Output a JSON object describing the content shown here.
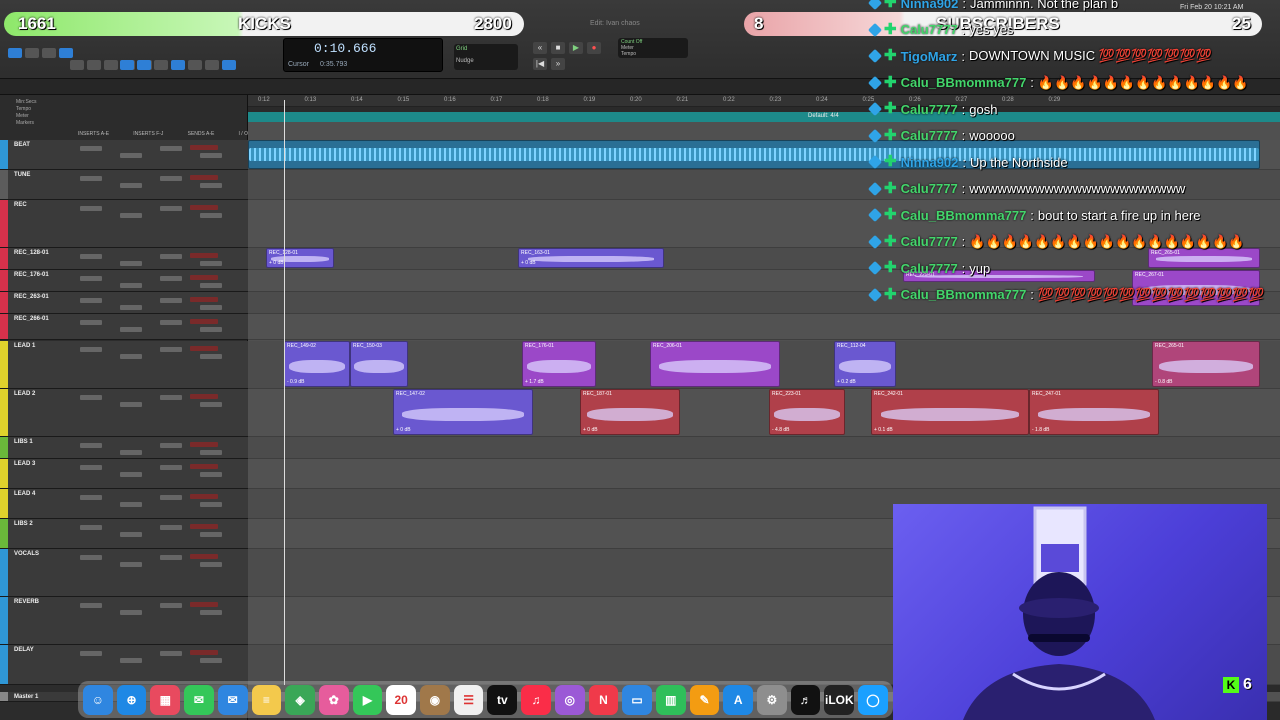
{
  "overlay": {
    "kicks_left": "1661",
    "kicks_label": "KICKS",
    "kicks_goal": "2800",
    "subs_left": "8",
    "subs_label": "SUBSCRIBERS",
    "subs_goal": "25",
    "kick_count": "6"
  },
  "protools": {
    "edit_window_title": "Edit: Ivan chaos",
    "counter_main": "0:10.666",
    "counter_cursor_label": "Cursor",
    "counter_cursor_value": "0:35.793",
    "grid_label": "Grid",
    "nudge_label": "Nudge",
    "tempo_label": "Tempo",
    "meter_label": "Meter",
    "count_off_label": "Count Off",
    "marker_text": "Default: 4/4",
    "ruler_ticks": [
      "0:12",
      "0:13",
      "0:14",
      "0:15",
      "0:16",
      "0:17",
      "0:18",
      "0:19",
      "0:20",
      "0:21",
      "0:22",
      "0:23",
      "0:24",
      "0:25",
      "0:26",
      "0:27",
      "0:28",
      "0:29"
    ],
    "insert_headers": [
      "INSERTS A-E",
      "INSERTS F-J",
      "SENDS A-E",
      "I / O"
    ],
    "top_rows": [
      "Min:Secs",
      "Tempo",
      "Meter",
      "Markers"
    ],
    "tracks": [
      {
        "name": "BEAT",
        "color": "#2f97d6"
      },
      {
        "name": "TUNE",
        "color": "#5c5c5c"
      },
      {
        "name": "REC",
        "color": "#d6314b"
      },
      {
        "name": "REC_128-01",
        "color": "#d6314b"
      },
      {
        "name": "REC_176-01",
        "color": "#d6314b"
      },
      {
        "name": "REC_263-01",
        "color": "#d6314b"
      },
      {
        "name": "REC_266-01",
        "color": "#d6314b"
      },
      {
        "name": "LEAD 1",
        "color": "#e0d22c"
      },
      {
        "name": "LEAD 2",
        "color": "#e0d22c"
      },
      {
        "name": "LIBS 1",
        "color": "#6ab83a"
      },
      {
        "name": "LEAD 3",
        "color": "#e0d22c"
      },
      {
        "name": "LEAD 4",
        "color": "#e0d22c"
      },
      {
        "name": "LIBS 2",
        "color": "#6ab83a"
      },
      {
        "name": "VOCALS",
        "color": "#2f97d6"
      },
      {
        "name": "REVERB",
        "color": "#2f97d6"
      },
      {
        "name": "DELAY",
        "color": "#2f97d6"
      },
      {
        "name": "Master 1",
        "color": "#888888"
      }
    ],
    "clips": [
      {
        "name": "REC_128-01",
        "gain": "+ 0 dB",
        "color": "#6a58d0"
      },
      {
        "name": "REC_163-01",
        "gain": "+ 0 dB",
        "color": "#6a58d0"
      },
      {
        "name": "REC_149-02",
        "gain": "- 0.9 dB",
        "color": "#6a58d0"
      },
      {
        "name": "REC_150-03",
        "gain": "",
        "color": "#6a58d0"
      },
      {
        "name": "REC_176-01",
        "gain": "+ 1.7 dB",
        "color": "#9b48c8"
      },
      {
        "name": "REC_206-01",
        "gain": "",
        "color": "#9b48c8"
      },
      {
        "name": "REC_112-04",
        "gain": "+ 0.2 dB",
        "color": "#6a58d0"
      },
      {
        "name": "REC_265-01",
        "gain": "- 0.8 dB",
        "color": "#b0457a"
      },
      {
        "name": "REC_147-02",
        "gain": "+ 0 dB",
        "color": "#6a58d0"
      },
      {
        "name": "REC_187-01",
        "gain": "+ 0 dB",
        "color": "#b0404a"
      },
      {
        "name": "REC_223-01",
        "gain": "- 4.8 dB",
        "color": "#b0404a"
      },
      {
        "name": "REC_242-01",
        "gain": "+ 0.1 dB",
        "color": "#b0404a"
      },
      {
        "name": "REC_247-01",
        "gain": "- 1.8 dB",
        "color": "#b0404a"
      },
      {
        "name": "REC_265-01",
        "gain": "",
        "color": "#9b48c8"
      },
      {
        "name": "REC_229-01",
        "gain": "",
        "color": "#9b48c8"
      },
      {
        "name": "REC_267-01",
        "gain": "",
        "color": "#9b48c8"
      }
    ]
  },
  "chat": [
    {
      "user": "Ninna902",
      "text": "Jamminnn. Not the plan b",
      "user_color": "#2fa4e7"
    },
    {
      "user": "Calu7777",
      "text": "yes yes",
      "user_color": "#43d66b"
    },
    {
      "user": "TigoMarz",
      "text": "DOWNTOWN MUSIC 💯💯💯💯💯💯💯",
      "user_color": "#2fa4e7"
    },
    {
      "user": "Calu_BBmomma777",
      "text": "🔥🔥🔥🔥🔥🔥🔥🔥🔥🔥🔥🔥🔥",
      "user_color": "#43d66b"
    },
    {
      "user": "Calu7777",
      "text": "gosh",
      "user_color": "#43d66b"
    },
    {
      "user": "Calu7777",
      "text": "wooooo",
      "user_color": "#43d66b"
    },
    {
      "user": "Ninna902",
      "text": "Up the Northside",
      "user_color": "#2fa4e7"
    },
    {
      "user": "Calu7777",
      "text": "wwwwwwwwwwwwwwwwwwwwwww",
      "user_color": "#43d66b"
    },
    {
      "user": "Calu_BBmomma777",
      "text": "bout to start a fire up in here",
      "user_color": "#43d66b"
    },
    {
      "user": "Calu7777",
      "text": "🔥🔥🔥🔥🔥🔥🔥🔥🔥🔥🔥🔥🔥🔥🔥🔥🔥",
      "user_color": "#43d66b"
    },
    {
      "user": "Calu7777",
      "text": "yup",
      "user_color": "#43d66b"
    },
    {
      "user": "Calu_BBmomma777",
      "text": "💯💯💯💯💯💯💯💯💯💯💯💯💯💯",
      "user_color": "#43d66b"
    }
  ],
  "menubar": {
    "date_time": "Fri Feb 20 10:21 AM"
  },
  "dock": [
    {
      "name": "Finder",
      "color": "#2f86e0",
      "glyph": "☺"
    },
    {
      "name": "Safari",
      "color": "#1e88e5",
      "glyph": "⊕"
    },
    {
      "name": "Launchpad",
      "color": "#e84a5f",
      "glyph": "▦"
    },
    {
      "name": "Messages",
      "color": "#34c759",
      "glyph": "✉"
    },
    {
      "name": "Mail",
      "color": "#2f86e0",
      "glyph": "✉"
    },
    {
      "name": "Notes",
      "color": "#f3c94c",
      "glyph": "≡"
    },
    {
      "name": "Maps",
      "color": "#3aa757",
      "glyph": "◈"
    },
    {
      "name": "Photos",
      "color": "#e65c9c",
      "glyph": "✿"
    },
    {
      "name": "FaceTime",
      "color": "#34c759",
      "glyph": "▶"
    },
    {
      "name": "Calendar",
      "color": "#ffffff",
      "glyph": "20"
    },
    {
      "name": "Contacts",
      "color": "#a0784a",
      "glyph": "◉"
    },
    {
      "name": "Reminders",
      "color": "#f0f0f0",
      "glyph": "☰"
    },
    {
      "name": "TV",
      "color": "#111111",
      "glyph": "tv"
    },
    {
      "name": "Music",
      "color": "#fa2d48",
      "glyph": "♫"
    },
    {
      "name": "Podcasts",
      "color": "#9b59d6",
      "glyph": "◎"
    },
    {
      "name": "News",
      "color": "#f03a4a",
      "glyph": "N"
    },
    {
      "name": "Keynote",
      "color": "#2f86e0",
      "glyph": "▭"
    },
    {
      "name": "Numbers",
      "color": "#2fbf5a",
      "glyph": "▥"
    },
    {
      "name": "Pages",
      "color": "#f39c12",
      "glyph": "✎"
    },
    {
      "name": "App Store",
      "color": "#1e88e5",
      "glyph": "A"
    },
    {
      "name": "System Settings",
      "color": "#8e8e8e",
      "glyph": "⚙"
    },
    {
      "name": "Logic",
      "color": "#111111",
      "glyph": "♬"
    },
    {
      "name": "iLok",
      "color": "#222222",
      "glyph": "iLOK"
    },
    {
      "name": "Kick",
      "color": "#1aa0ff",
      "glyph": "◯"
    }
  ],
  "dock_calendar_day": "20"
}
